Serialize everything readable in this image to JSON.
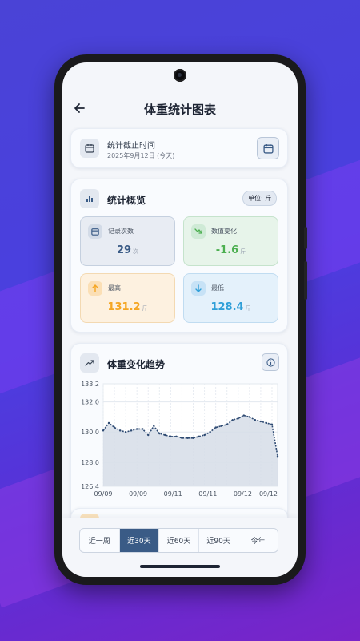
{
  "header": {
    "title": "体重统计图表"
  },
  "date_card": {
    "label": "统计截止时间",
    "date": "2025年9月12日 (今天)"
  },
  "overview": {
    "title": "统计概览",
    "unit_badge": "单位: 斤",
    "stats": [
      {
        "label": "记录次数",
        "value": "29",
        "unit": "次",
        "color": "#3a5b86",
        "icon": "calendar-icon"
      },
      {
        "label": "数值变化",
        "value": "-1.6",
        "unit": "斤",
        "color": "#4caf50",
        "icon": "trend-down-icon"
      },
      {
        "label": "最高",
        "value": "131.2",
        "unit": "斤",
        "color": "#f5a623",
        "icon": "arrow-up-icon"
      },
      {
        "label": "最低",
        "value": "128.4",
        "unit": "斤",
        "color": "#2f9fd8",
        "icon": "arrow-down-icon"
      }
    ]
  },
  "trend": {
    "title": "体重变化趋势"
  },
  "chart_data": {
    "type": "area",
    "title": "",
    "xlabel": "",
    "ylabel": "",
    "ylim": [
      126.4,
      133.2
    ],
    "y_ticks": [
      "133.2",
      "132.0",
      "130.0",
      "128.0",
      "126.4"
    ],
    "y_tick_values": [
      133.2,
      132.0,
      130.0,
      128.0,
      126.4
    ],
    "x_tick_labels": [
      "09/09",
      "09/09",
      "09/11",
      "09/11",
      "09/12",
      "09/12"
    ],
    "values": [
      130.1,
      130.6,
      130.3,
      130.1,
      130.0,
      130.1,
      130.2,
      130.2,
      129.8,
      130.4,
      129.9,
      129.8,
      129.7,
      129.7,
      129.6,
      129.6,
      129.6,
      129.7,
      129.8,
      130.0,
      130.3,
      130.4,
      130.5,
      130.8,
      130.9,
      131.1,
      131.0,
      130.8,
      130.7,
      130.6,
      130.5,
      128.4
    ],
    "grid": true,
    "line_color": "#2f4b73",
    "fill_color": "#d6dde8"
  },
  "range_tabs": {
    "items": [
      "近一周",
      "近30天",
      "近60天",
      "近90天",
      "今年"
    ],
    "active": "近30天"
  },
  "colors": {
    "accent": "#3a5b86"
  }
}
